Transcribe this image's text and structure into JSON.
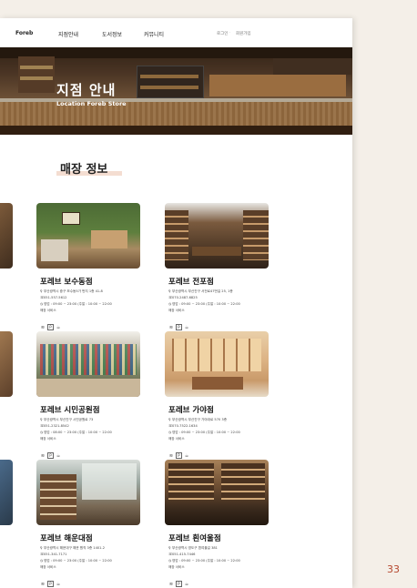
{
  "nav": {
    "logo": "Foreb",
    "items": [
      "지점안내",
      "도서정보",
      "커뮤니티"
    ],
    "login": "로그인",
    "signup": "회원가입"
  },
  "hero": {
    "title": "지점 안내",
    "subtitle": "Location Foreb Store"
  },
  "section_title": "매장 정보",
  "stores": [
    {
      "name": "포레브 보수동점",
      "address": "부산광역시 중구 보수동5가 번지 1층 41-8",
      "phone": "051-557-5612",
      "hours": "영업 : 09:00 ~ 23:00 (주말 : 10:00 ~ 22:00",
      "services_label": "매장 서비스"
    },
    {
      "name": "포레브 전포점",
      "address": "부산광역시 부산진구 서전로47번길 25, 1층",
      "phone": "070-2487-6825",
      "hours": "영업 : 09:00 ~ 23:00 (주말 : 10:00 ~ 22:00",
      "services_label": "매장 서비스"
    },
    {
      "name": "포레브 시민공원점",
      "address": "부산광역시 부산진구 시민공원로 73",
      "phone": "051-2321-8542",
      "hours": "영업 : 08:00 ~ 23:00 (주말 : 10:00 ~ 22:00",
      "services_label": "매장 서비스"
    },
    {
      "name": "포레브 가야점",
      "address": "부산광역시 부산진구 가야대로 570 3층",
      "phone": "070-7522-1634",
      "hours": "영업 : 09:00 ~ 23:00 (주말 : 10:00 ~ 22:00",
      "services_label": "매장 서비스"
    },
    {
      "name": "포레브 해운대점",
      "address": "부산광역시 해운대구 해운 원직 3층 1401-2",
      "phone": "051-341-7171",
      "hours": "영업 : 09:00 ~ 23:00 (주말 : 10:00 ~ 22:00",
      "services_label": "매장 서비스"
    },
    {
      "name": "포레브 흰여울점",
      "address": "부산광역시 영도구 흰여울길 381",
      "phone": "051-415-7446",
      "hours": "영업 : 09:00 ~ 23:00 (주말 : 10:00 ~ 22:00",
      "services_label": "매장 서비스"
    }
  ],
  "service_icons": [
    "wifi-icon",
    "parking-icon",
    "cafe-icon"
  ],
  "page_number": "33",
  "colors": {
    "accent": "#b5482f",
    "underline": "#f4ddd1",
    "background": "#f4efe8"
  }
}
